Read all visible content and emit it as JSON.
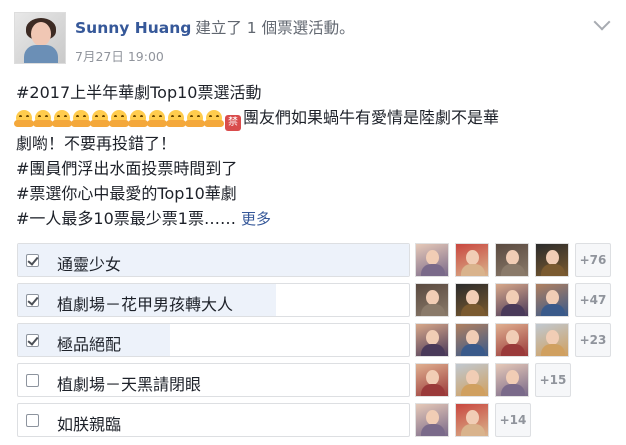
{
  "post": {
    "author": "Sunny Huang",
    "action": "建立了 1 個票選活動。",
    "time": "7月27日 19:00",
    "lines": {
      "title": "#2017上半年華劇Top10票選活動",
      "warning_part1": "團友們如果蝸牛有愛情是陸劇不是華",
      "warning_part2": "劇喲！不要再投錯了！",
      "line4": "#團員們浮出水面投票時間到了",
      "line5": "#票選你心中最愛的Top10華劇",
      "line6": "#一人最多10票最少票1票……"
    },
    "more_link": "更多",
    "emoji_count": 11,
    "forbidden_glyph": "禁"
  },
  "poll": {
    "options": [
      {
        "label": "通靈少女",
        "checked": true,
        "fill": 1.0,
        "count": "+76",
        "voters": 4
      },
      {
        "label": "植劇場－花甲男孩轉大人",
        "checked": true,
        "fill": 0.66,
        "count": "+47",
        "voters": 4
      },
      {
        "label": "極品絕配",
        "checked": true,
        "fill": 0.39,
        "count": "+23",
        "voters": 4
      },
      {
        "label": "植劇場－天黑請閉眼",
        "checked": false,
        "fill": 0.0,
        "count": "+15",
        "voters": 3
      },
      {
        "label": "如朕親臨",
        "checked": false,
        "fill": 0.0,
        "count": "+14",
        "voters": 2
      }
    ]
  },
  "colors": {
    "link": "#365899",
    "fill": "#edf2fa",
    "border": "#dddfe2",
    "muted": "#90949c"
  }
}
